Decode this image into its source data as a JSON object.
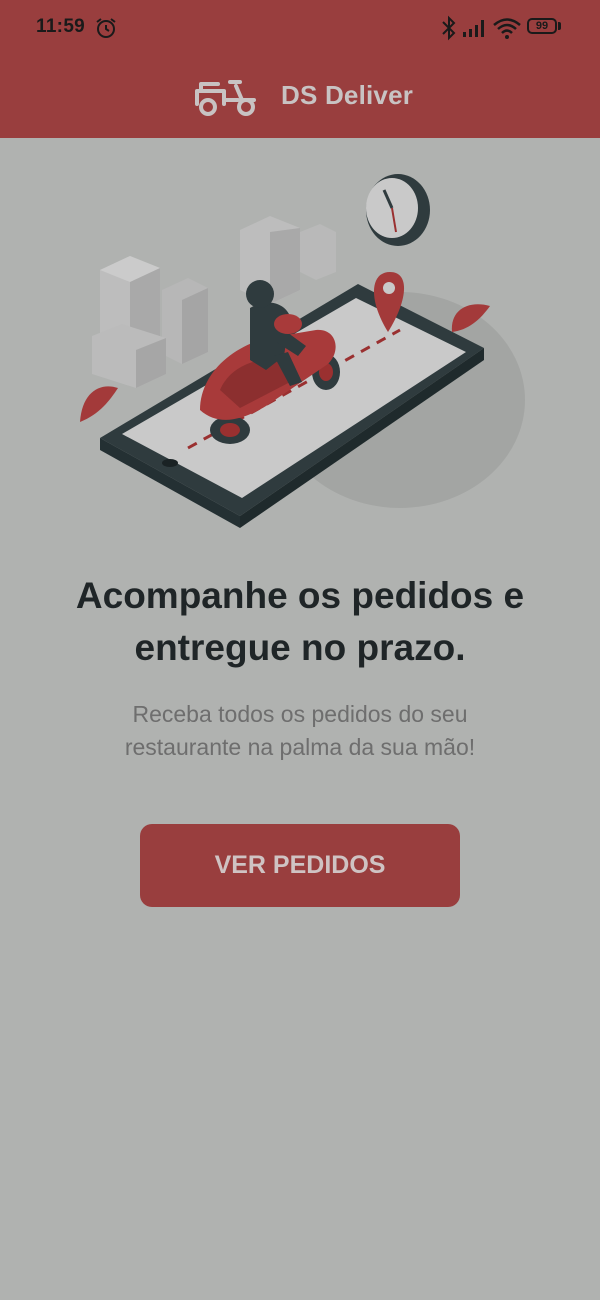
{
  "status_bar": {
    "time": "11:59",
    "battery": "99",
    "icons": [
      "alarm-icon",
      "bluetooth-icon",
      "signal-icon",
      "wifi-icon",
      "battery-icon"
    ]
  },
  "header": {
    "title": "DS Deliver",
    "logo_icon": "scooter-icon",
    "background_color": "#993e3e"
  },
  "hero": {
    "illustration": "delivery-scooter-on-phone-illustration",
    "headline_line1": "Acompanhe os pedidos e",
    "headline_line2": "entregue no prazo.",
    "subtitle_line1": "Receba todos os pedidos do seu",
    "subtitle_line2": "restaurante na palma da sua mão!"
  },
  "cta": {
    "label": "VER PEDIDOS",
    "color": "#993e3e"
  }
}
